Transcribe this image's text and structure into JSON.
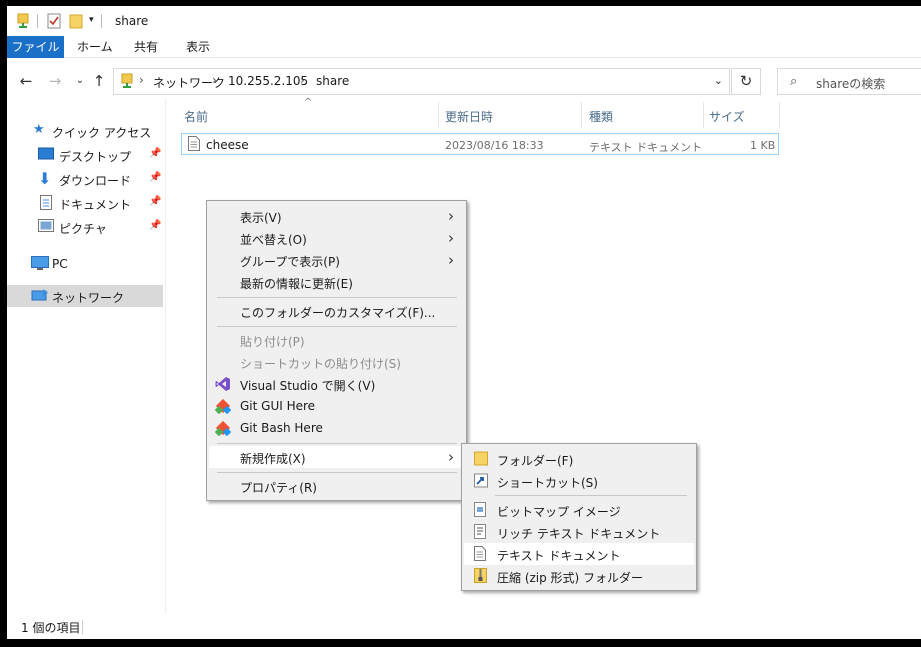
{
  "window": {
    "title": "share"
  },
  "ribbon": {
    "tabs": [
      "ファイル",
      "ホーム",
      "共有",
      "表示"
    ]
  },
  "address": {
    "crumbs": [
      "ネットワーク",
      "10.255.2.105",
      "share"
    ],
    "separator": "›"
  },
  "search": {
    "placeholder": "shareの検索"
  },
  "nav": {
    "quick_access": "クイック アクセス",
    "desktop": "デスクトップ",
    "downloads": "ダウンロード",
    "documents": "ドキュメント",
    "pictures": "ピクチャ",
    "pc": "PC",
    "network": "ネットワーク"
  },
  "columns": {
    "name": "名前",
    "date": "更新日時",
    "type": "種類",
    "size": "サイズ"
  },
  "files": [
    {
      "name": "cheese",
      "date": "2023/08/16 18:33",
      "type": "テキスト ドキュメント",
      "size": "1 KB"
    }
  ],
  "status": {
    "count": "1 個の項目"
  },
  "context_menu": {
    "view": "表示(V)",
    "sort": "並べ替え(O)",
    "group": "グループで表示(P)",
    "refresh": "最新の情報に更新(E)",
    "customize": "このフォルダーのカスタマイズ(F)...",
    "paste": "貼り付け(P)",
    "paste_shortcut": "ショートカットの貼り付け(S)",
    "vs_open": "Visual Studio で開く(V)",
    "git_gui": "Git GUI Here",
    "git_bash": "Git Bash Here",
    "new": "新規作成(X)",
    "properties": "プロパティ(R)"
  },
  "submenu": {
    "folder": "フォルダー(F)",
    "shortcut": "ショートカット(S)",
    "bitmap": "ビットマップ イメージ",
    "rtf": "リッチ テキスト ドキュメント",
    "text": "テキスト ドキュメント",
    "zip": "圧縮 (zip 形式) フォルダー"
  },
  "colors": {
    "file_tab": "#1a6fc7",
    "selection_border": "#99d1ff",
    "menu_bg": "#f0f0f0"
  }
}
